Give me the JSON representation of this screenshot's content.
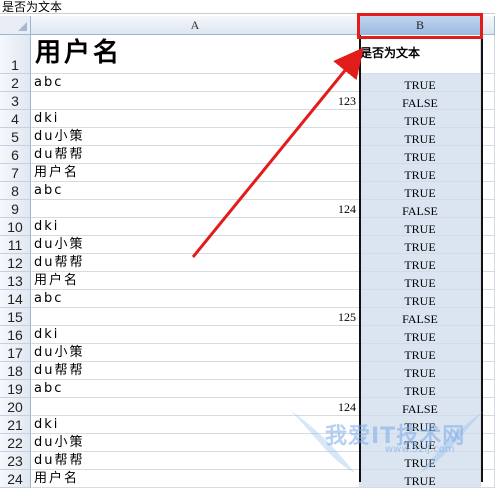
{
  "formula_bar": {
    "content": "是否为文本"
  },
  "columns": [
    {
      "letter": "A"
    },
    {
      "letter": "B"
    }
  ],
  "rows": [
    {
      "num": "1",
      "a": "用户名",
      "a_type": "big",
      "b": "是否为文本"
    },
    {
      "num": "2",
      "a": "abc",
      "a_type": "text",
      "b": "TRUE"
    },
    {
      "num": "3",
      "a": "123",
      "a_type": "num",
      "b": "FALSE"
    },
    {
      "num": "4",
      "a": "dki",
      "a_type": "text",
      "b": "TRUE"
    },
    {
      "num": "5",
      "a": "du小策",
      "a_type": "text",
      "b": "TRUE"
    },
    {
      "num": "6",
      "a": "du帮帮",
      "a_type": "text",
      "b": "TRUE"
    },
    {
      "num": "7",
      "a": "用户名",
      "a_type": "text",
      "b": "TRUE"
    },
    {
      "num": "8",
      "a": "abc",
      "a_type": "text",
      "b": "TRUE"
    },
    {
      "num": "9",
      "a": "124",
      "a_type": "num",
      "b": "FALSE"
    },
    {
      "num": "10",
      "a": "dki",
      "a_type": "text",
      "b": "TRUE"
    },
    {
      "num": "11",
      "a": "du小策",
      "a_type": "text",
      "b": "TRUE"
    },
    {
      "num": "12",
      "a": "du帮帮",
      "a_type": "text",
      "b": "TRUE"
    },
    {
      "num": "13",
      "a": "用户名",
      "a_type": "text",
      "b": "TRUE"
    },
    {
      "num": "14",
      "a": "abc",
      "a_type": "text",
      "b": "TRUE"
    },
    {
      "num": "15",
      "a": "125",
      "a_type": "num",
      "b": "FALSE"
    },
    {
      "num": "16",
      "a": "dki",
      "a_type": "text",
      "b": "TRUE"
    },
    {
      "num": "17",
      "a": "du小策",
      "a_type": "text",
      "b": "TRUE"
    },
    {
      "num": "18",
      "a": "du帮帮",
      "a_type": "text",
      "b": "TRUE"
    },
    {
      "num": "19",
      "a": "abc",
      "a_type": "text",
      "b": "TRUE"
    },
    {
      "num": "20",
      "a": "124",
      "a_type": "num",
      "b": "FALSE"
    },
    {
      "num": "21",
      "a": "dki",
      "a_type": "text",
      "b": "TRUE"
    },
    {
      "num": "22",
      "a": "du小策",
      "a_type": "text",
      "b": "TRUE"
    },
    {
      "num": "23",
      "a": "du帮帮",
      "a_type": "text",
      "b": "TRUE"
    },
    {
      "num": "24",
      "a": "用户名",
      "a_type": "text",
      "b": "TRUE"
    }
  ],
  "watermark": {
    "text": "我爱IT技术网",
    "sub": "www.52ij.com"
  },
  "colors": {
    "annotation": "#e21b1b",
    "selected_column": "#dbe5f2",
    "header": "#dde6f1"
  }
}
